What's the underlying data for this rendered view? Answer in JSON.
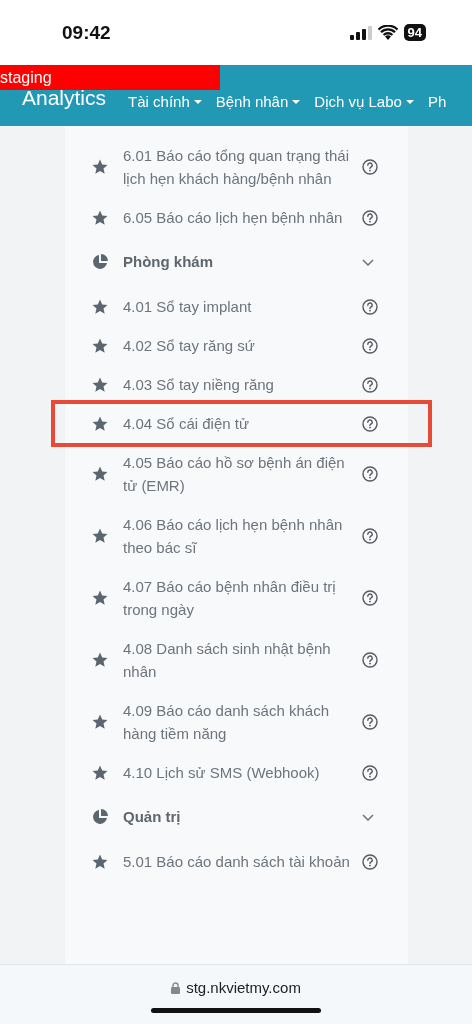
{
  "status_bar": {
    "time": "09:42",
    "battery": "94"
  },
  "staging_banner": "staging",
  "navbar": {
    "brand": "Analytics",
    "menus": [
      {
        "label": "Tài chính",
        "dropdown": true
      },
      {
        "label": "Bệnh nhân",
        "dropdown": true
      },
      {
        "label": "Dịch vụ Labo",
        "dropdown": true
      },
      {
        "label": "Ph",
        "dropdown": false
      }
    ]
  },
  "groups": [
    {
      "items": [
        {
          "label": "6.01 Báo cáo tổng quan trạng thái lịch hẹn khách hàng/bệnh nhân",
          "highlighted": false
        },
        {
          "label": "6.05 Báo cáo lịch hẹn bệnh nhân",
          "highlighted": false
        }
      ]
    },
    {
      "title": "Phòng khám",
      "expanded": true,
      "items": [
        {
          "label": "4.01 Sổ tay implant",
          "highlighted": false
        },
        {
          "label": "4.02 Sổ tay răng sứ",
          "highlighted": false
        },
        {
          "label": "4.03 Sổ tay niềng răng",
          "highlighted": false
        },
        {
          "label": "4.04 Sổ cái điện tử",
          "highlighted": true
        },
        {
          "label": "4.05 Báo cáo hồ sơ bệnh án điện tử (EMR)",
          "highlighted": false
        },
        {
          "label": "4.06 Báo cáo lịch hẹn bệnh nhân theo bác sĩ",
          "highlighted": false
        },
        {
          "label": "4.07 Báo cáo bệnh nhân điều trị trong ngày",
          "highlighted": false
        },
        {
          "label": "4.08 Danh sách sinh nhật bệnh nhân",
          "highlighted": false
        },
        {
          "label": "4.09 Báo cáo danh sách khách hàng tiềm năng",
          "highlighted": false
        },
        {
          "label": "4.10 Lịch sử SMS (Webhook)",
          "highlighted": false
        }
      ]
    },
    {
      "title": "Quản trị",
      "expanded": true,
      "items": [
        {
          "label": "5.01 Báo cáo danh sách tài khoản",
          "highlighted": false
        }
      ]
    }
  ],
  "url_bar": {
    "url": "stg.nkvietmy.com"
  }
}
